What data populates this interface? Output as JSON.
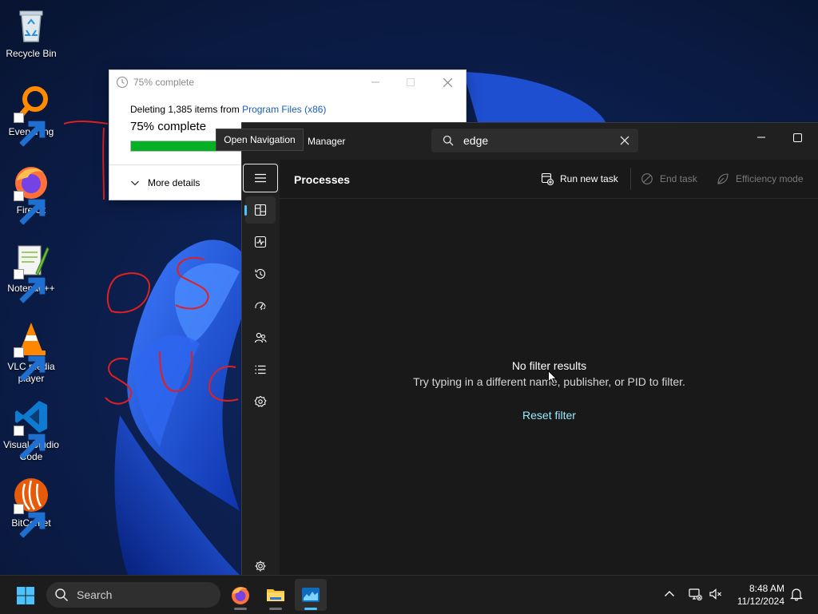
{
  "desktop": {
    "icons": [
      {
        "label": "Recycle Bin"
      },
      {
        "label": "Everything"
      },
      {
        "label": "Firefox"
      },
      {
        "label": "Notepad++"
      },
      {
        "label": "VLC media player"
      },
      {
        "label": "Visual Studio Code"
      },
      {
        "label": "BitComet"
      }
    ]
  },
  "copy_dialog": {
    "title": "75% complete",
    "status_prefix": "Deleting 1,385 items from ",
    "status_link": "Program Files (x86)",
    "percent_text": "75% complete",
    "progress": 0.75,
    "more_details": "More details"
  },
  "task_manager": {
    "app_name": "Manager",
    "tooltip": "Open Navigation",
    "search": {
      "value": "edge"
    },
    "page_title": "Processes",
    "commands": {
      "run_new_task": "Run new task",
      "end_task": "End task",
      "efficiency_mode": "Efficiency mode"
    },
    "empty": {
      "title": "No filter results",
      "subtitle": "Try typing in a different name, publisher, or PID to filter.",
      "reset": "Reset filter"
    },
    "nav_icons": [
      "processes-icon",
      "performance-icon",
      "app-history-icon",
      "startup-apps-icon",
      "users-icon",
      "details-icon",
      "services-icon",
      "settings-icon"
    ]
  },
  "taskbar": {
    "search_label": "Search",
    "apps": [
      "firefox-icon",
      "file-explorer-icon",
      "task-manager-icon"
    ],
    "time": "8:48 AM",
    "date": "11/12/2024"
  },
  "colors": {
    "accent": "#4cc2ff",
    "progress_green": "#06b025",
    "link_blue": "#1a5fb4",
    "reset_link": "#99ebff"
  }
}
